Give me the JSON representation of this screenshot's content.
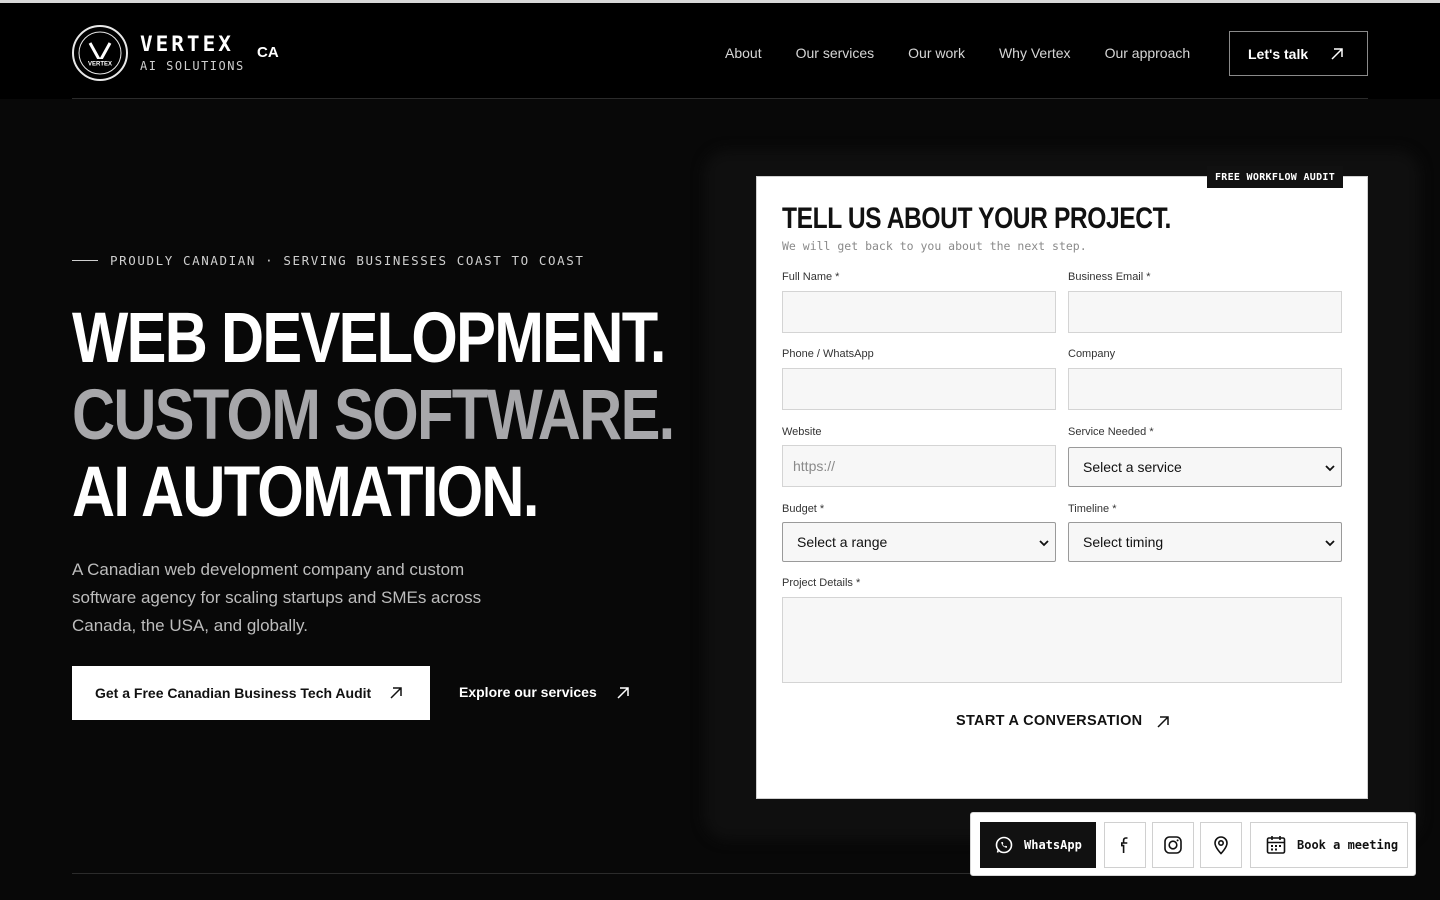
{
  "header": {
    "brand_name": "VERTEX",
    "brand_sub": "AI SOLUTIONS",
    "region": "CA",
    "logo_text": "VERTEX",
    "nav": [
      "About",
      "Our services",
      "Our work",
      "Why Vertex",
      "Our approach"
    ],
    "cta_label": "Let's talk"
  },
  "hero": {
    "eyebrow": "PROUDLY CANADIAN · SERVING BUSINESSES COAST TO COAST",
    "headline_line1": "WEB DEVELOPMENT.",
    "headline_line2": "CUSTOM SOFTWARE.",
    "headline_line3": "AI AUTOMATION.",
    "description": "A Canadian web development company and custom software agency for scaling startups and SMEs across Canada, the USA, and globally.",
    "cta_primary": "Get a Free Canadian Business Tech Audit",
    "cta_secondary": "Explore our services"
  },
  "form": {
    "tag": "FREE WORKFLOW AUDIT",
    "title": "TELL US ABOUT YOUR PROJECT.",
    "subtitle": "We will get back to you about the next step.",
    "full_name_label": "Full Name *",
    "email_label": "Business Email *",
    "phone_label": "Phone / WhatsApp",
    "company_label": "Company",
    "website_label": "Website",
    "website_placeholder": "https://",
    "service_label": "Service Needed *",
    "service_value": "Select a service",
    "budget_label": "Budget *",
    "budget_value": "Select a range",
    "timeline_label": "Timeline *",
    "timeline_value": "Select timing",
    "details_label": "Project Details *",
    "submit_label": "START A CONVERSATION"
  },
  "floating_bar": {
    "whatsapp_label": "WhatsApp",
    "book_label": "Book a meeting"
  },
  "colors": {
    "background": "#080808",
    "accent_text": "#ffffff",
    "muted_headline": "#a7a7aa"
  }
}
